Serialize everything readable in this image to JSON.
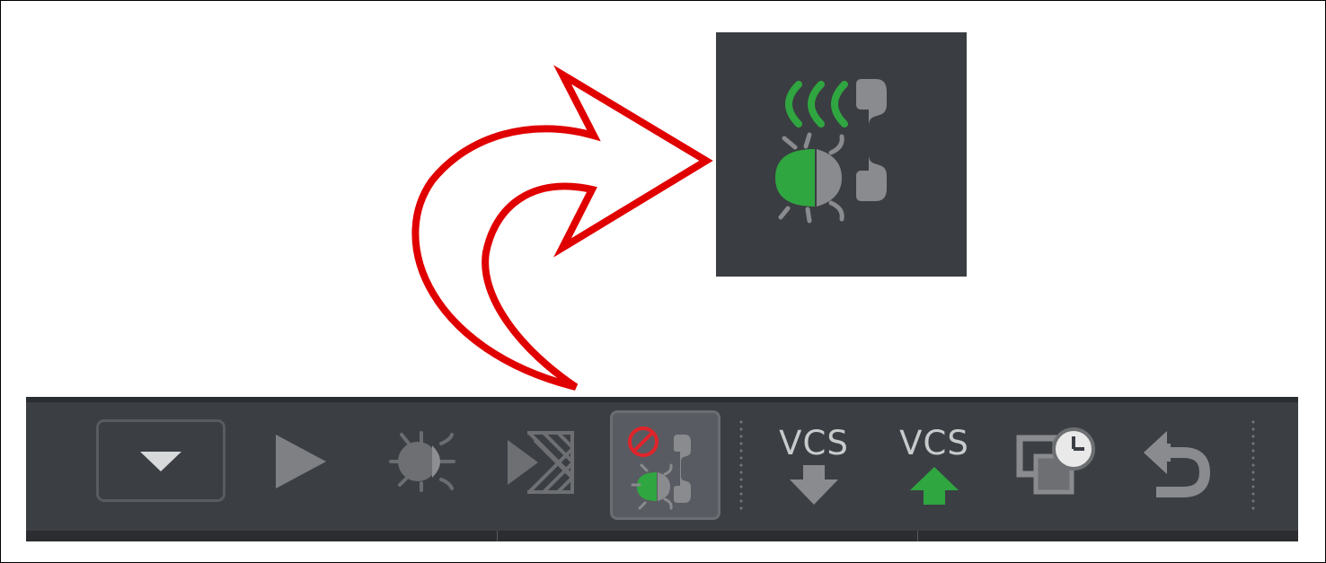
{
  "toolbar": {
    "vcs_update_label": "VCS",
    "vcs_commit_label": "VCS"
  },
  "colors": {
    "toolbar_bg": "#3b3f44",
    "zoom_bg": "#3a3d41",
    "icon_gray": "#8a8b8e",
    "icon_green": "#2fa640",
    "arrow_red": "#e00000",
    "no_sign_red": "#e0242a"
  },
  "icons": [
    "run-configuration-dropdown-icon",
    "run-icon",
    "debug-icon",
    "run-with-coverage-icon",
    "attach-debugger-icon",
    "vcs-update-icon",
    "vcs-commit-icon",
    "history-icon",
    "revert-icon"
  ]
}
